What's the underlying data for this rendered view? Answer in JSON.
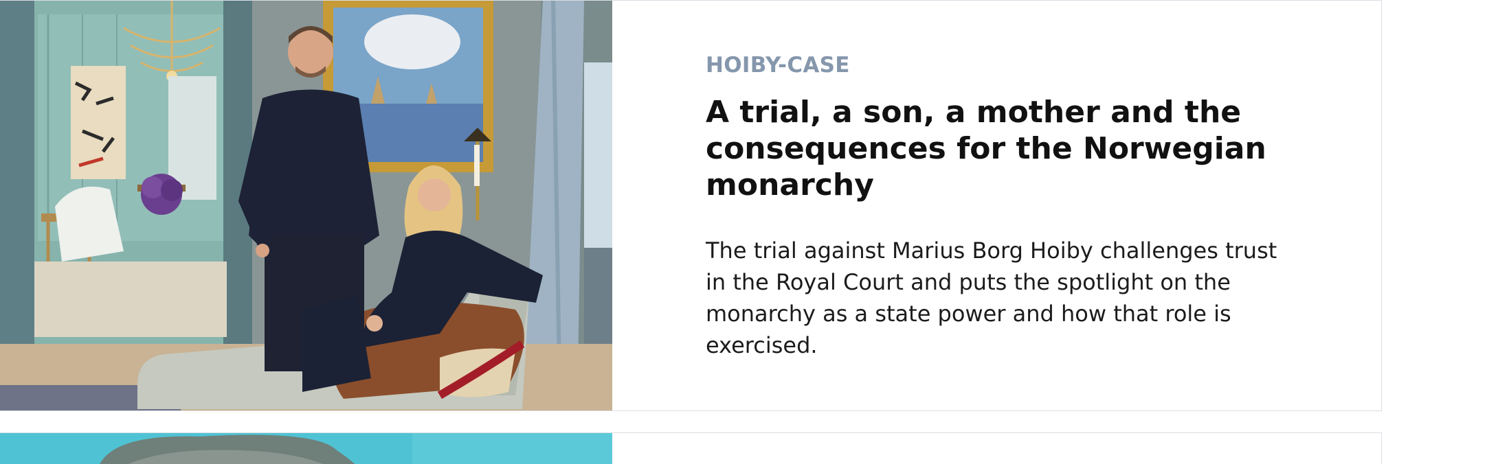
{
  "articles": [
    {
      "kicker": "HOIBY-CASE",
      "headline": "A trial, a son, a mother and the consequences for the Norwegian monarchy",
      "summary": "The trial against Marius Borg Hoiby challenges trust in the Royal Court and puts the spotlight on the monarchy as a state power and how that role is exercised.",
      "image_subject": "royal-couple-portrait-photo"
    },
    {
      "image_subject": "person-portrait-photo"
    }
  ],
  "colors": {
    "kicker": "#8597ac",
    "headline": "#111111",
    "summary": "#1b1b1b",
    "card_border": "#d9dde3",
    "teal_bg": "#4fc3d4"
  }
}
